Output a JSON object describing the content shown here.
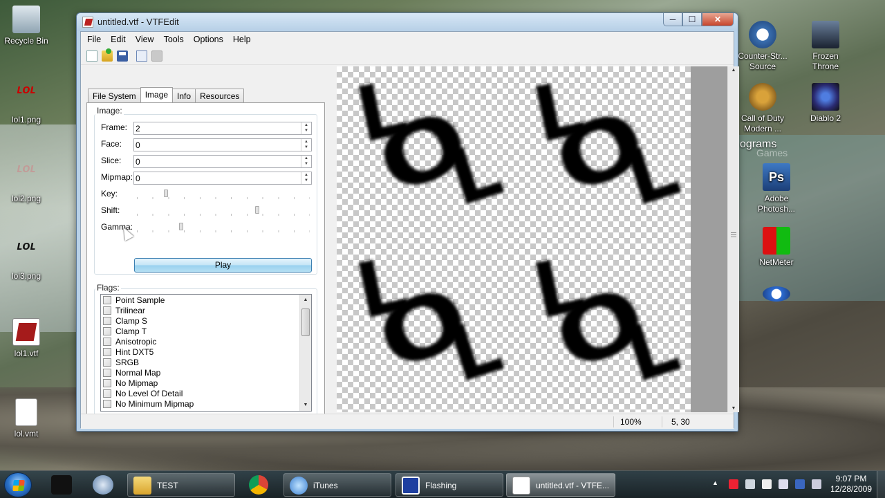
{
  "window": {
    "title": "untitled.vtf - VTFEdit",
    "minimize": "─",
    "maximize": "☐",
    "close": "✕"
  },
  "menu": [
    "File",
    "Edit",
    "View",
    "Tools",
    "Options",
    "Help"
  ],
  "tabs": [
    {
      "label": "File System",
      "active": false
    },
    {
      "label": "Image",
      "active": true
    },
    {
      "label": "Info",
      "active": false
    },
    {
      "label": "Resources",
      "active": false
    }
  ],
  "image_panel": {
    "group_label": "Image:",
    "frame_label": "Frame:",
    "frame_value": "2",
    "face_label": "Face:",
    "face_value": "0",
    "slice_label": "Slice:",
    "slice_value": "0",
    "mipmap_label": "Mipmap:",
    "mipmap_value": "0",
    "key_label": "Key:",
    "key_level": 0.16,
    "shift_label": "Shift:",
    "shift_level": 0.7,
    "gamma_label": "Gamma:",
    "gamma_level": 0.25,
    "play_label": "Play"
  },
  "flags": {
    "group_label": "Flags:",
    "items": [
      "Point Sample",
      "Trilinear",
      "Clamp S",
      "Clamp T",
      "Anisotropic",
      "Hint DXT5",
      "SRGB",
      "Normal Map",
      "No Mipmap",
      "No Level Of Detail",
      "No Minimum Mipmap"
    ]
  },
  "preview": {
    "text": "LOL"
  },
  "status": {
    "zoom": "100%",
    "coords": "5, 30"
  },
  "desktop_left": [
    {
      "label": "Recycle Bin"
    },
    {
      "label": "lol1.png"
    },
    {
      "label": "lol2.png"
    },
    {
      "label": "lol3.png"
    },
    {
      "label": "lol1.vtf"
    },
    {
      "label": "lol.vmt"
    }
  ],
  "desktop_right": [
    {
      "label": "Counter-Str... Source"
    },
    {
      "label": "Frozen Throne"
    },
    {
      "label": "Call of Duty Modern ..."
    },
    {
      "label": "Diablo 2"
    },
    {
      "label": "Adobe Photosh..."
    },
    {
      "label": "NetMeter"
    }
  ],
  "programs_label": "ograms",
  "games_label": "Games",
  "taskbar": {
    "tasks": [
      {
        "label": "TEST"
      },
      {
        "label": "iTunes"
      },
      {
        "label": "Flashing"
      },
      {
        "label": "untitled.vtf - VTFE..."
      }
    ],
    "time": "9:07 PM",
    "date": "12/28/2009"
  }
}
